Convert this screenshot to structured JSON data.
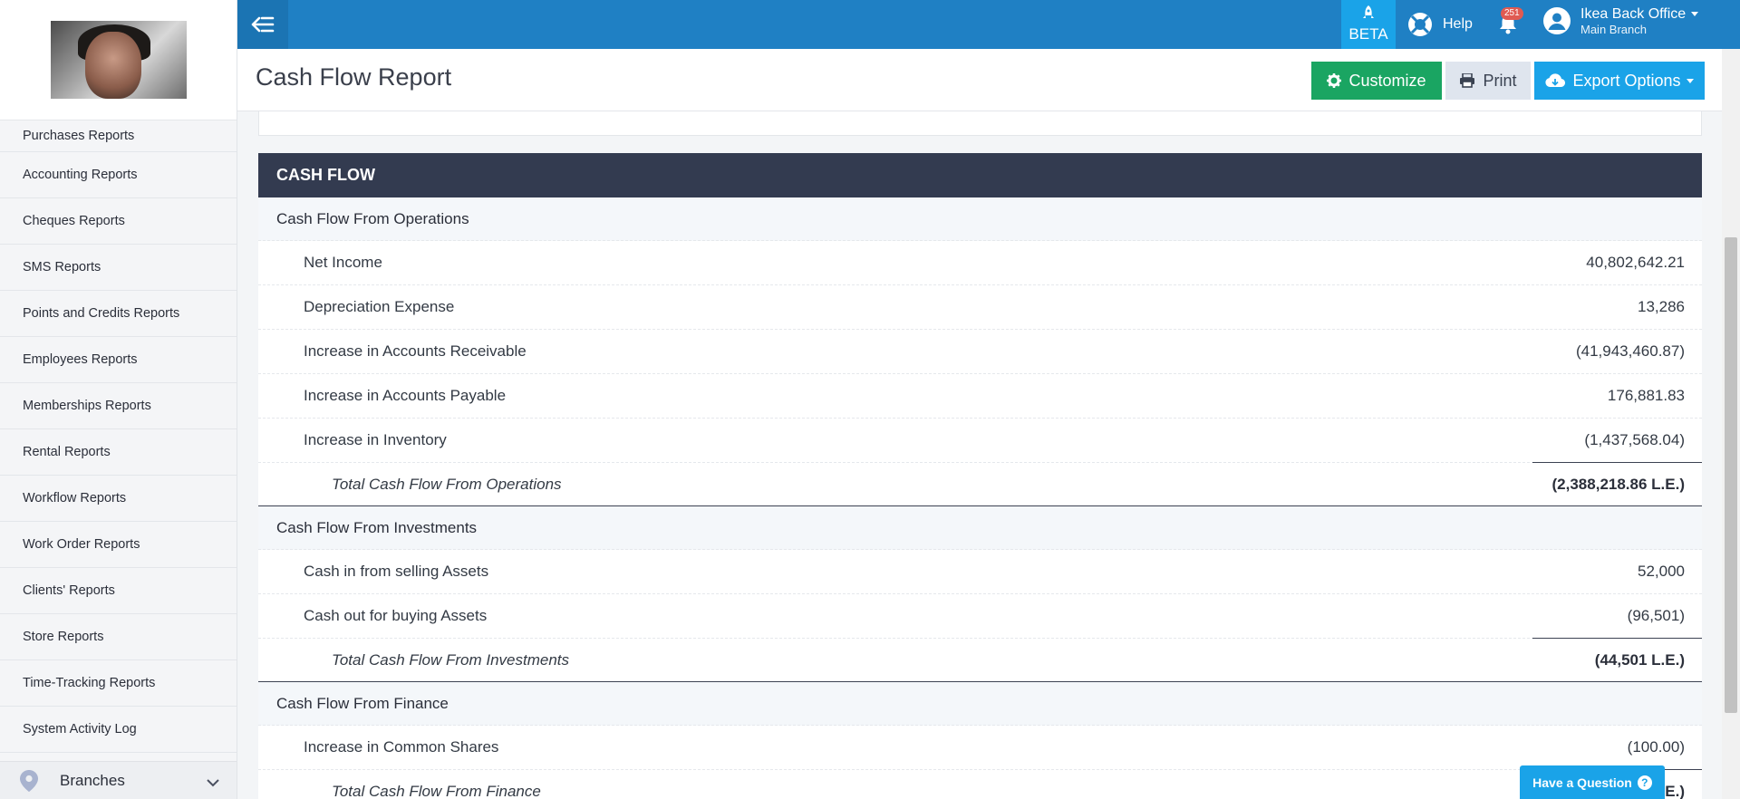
{
  "sidebar": {
    "items": [
      {
        "label": "Purchases Reports"
      },
      {
        "label": "Accounting Reports"
      },
      {
        "label": "Cheques Reports"
      },
      {
        "label": "SMS Reports"
      },
      {
        "label": "Points and Credits Reports"
      },
      {
        "label": "Employees Reports"
      },
      {
        "label": "Memberships Reports"
      },
      {
        "label": "Rental Reports"
      },
      {
        "label": "Workflow Reports"
      },
      {
        "label": "Work Order Reports"
      },
      {
        "label": "Clients' Reports"
      },
      {
        "label": "Store Reports"
      },
      {
        "label": "Time-Tracking Reports"
      },
      {
        "label": "System Activity Log"
      }
    ],
    "bottom_label": "Branches"
  },
  "topbar": {
    "beta_label": "BETA",
    "help_label": "Help",
    "notification_count": "251",
    "user_name": "Ikea Back Office",
    "user_branch": "Main Branch",
    "accent_color": "#1f80c4"
  },
  "header": {
    "title": "Cash Flow Report",
    "customize_label": "Customize",
    "print_label": "Print",
    "export_label": "Export Options"
  },
  "report": {
    "title": "CASH FLOW",
    "sections": [
      {
        "title": "Cash Flow From Operations",
        "rows": [
          {
            "label": "Net Income",
            "value": "40,802,642.21"
          },
          {
            "label": "Depreciation Expense",
            "value": "13,286"
          },
          {
            "label": "Increase in Accounts Receivable",
            "value": "(41,943,460.87)"
          },
          {
            "label": "Increase in Accounts Payable",
            "value": "176,881.83"
          },
          {
            "label": "Increase in Inventory",
            "value": "(1,437,568.04)"
          }
        ],
        "total_label": "Total Cash Flow From Operations",
        "total_value": "(2,388,218.86 L.E.)"
      },
      {
        "title": "Cash Flow From Investments",
        "rows": [
          {
            "label": "Cash in from selling Assets",
            "value": "52,000"
          },
          {
            "label": "Cash out for buying Assets",
            "value": "(96,501)"
          }
        ],
        "total_label": "Total Cash Flow From Investments",
        "total_value": "(44,501 L.E.)"
      },
      {
        "title": "Cash Flow From Finance",
        "rows": [
          {
            "label": "Increase in Common Shares",
            "value": "(100.00)"
          }
        ],
        "total_label": "Total Cash Flow From Finance",
        "total_value": "E.)"
      }
    ]
  },
  "help_fab": {
    "label": "Have a Question",
    "q_mark": "?"
  }
}
